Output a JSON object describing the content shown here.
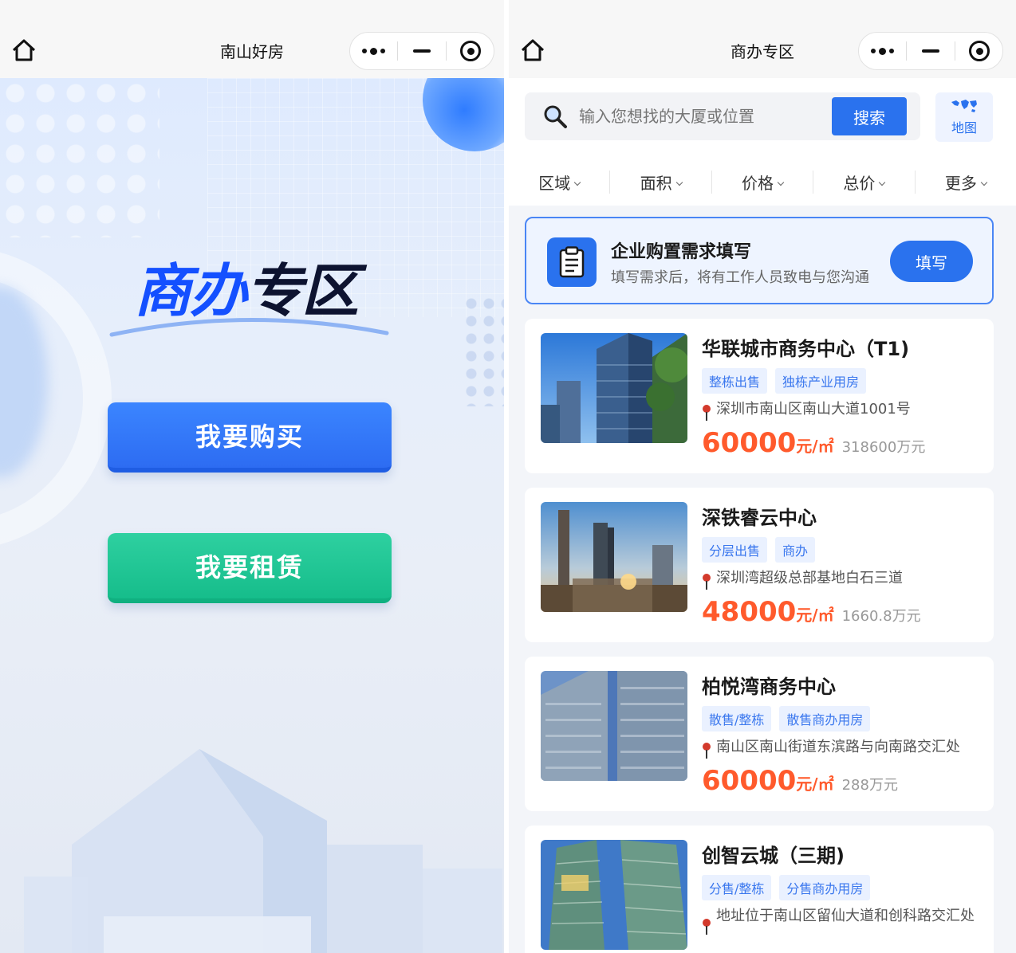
{
  "left": {
    "nav_title": "南山好房",
    "logo_blue": "商办",
    "logo_dark": "专区",
    "buy_label": "我要购买",
    "rent_label": "我要租赁"
  },
  "right": {
    "nav_title": "商办专区",
    "search": {
      "placeholder": "输入您想找的大厦或位置",
      "button_label": "搜索",
      "map_label": "地图"
    },
    "filters": [
      "区域",
      "面积",
      "价格",
      "总价",
      "更多"
    ],
    "requirement": {
      "title": "企业购置需求填写",
      "subtitle": "填写需求后，将有工作人员致电与您沟通",
      "button_label": "填写"
    },
    "listings": [
      {
        "title": "华联城市商务中心（T1)",
        "tags": [
          "整栋出售",
          "独栋产业用房"
        ],
        "address": "深圳市南山区南山大道1001号",
        "price": "60000",
        "unit": "元/㎡",
        "total": "318600万元"
      },
      {
        "title": "深铁睿云中心",
        "tags": [
          "分层出售",
          "商办"
        ],
        "address": "深圳湾超级总部基地白石三道",
        "price": "48000",
        "unit": "元/㎡",
        "total": "1660.8万元"
      },
      {
        "title": "柏悦湾商务中心",
        "tags": [
          "散售/整栋",
          "散售商办用房"
        ],
        "address": "南山区南山街道东滨路与向南路交汇处",
        "price": "60000",
        "unit": "元/㎡",
        "total": "288万元"
      },
      {
        "title": "创智云城（三期)",
        "tags": [
          "分售/整栋",
          "分售商办用房"
        ],
        "address": "地址位于南山区留仙大道和创科路交汇处",
        "price": "",
        "unit": "",
        "total": ""
      }
    ]
  },
  "colors": {
    "brand_blue": "#2a72ee",
    "rent_green": "#16bd8b",
    "price_orange": "#ff5a2c"
  }
}
